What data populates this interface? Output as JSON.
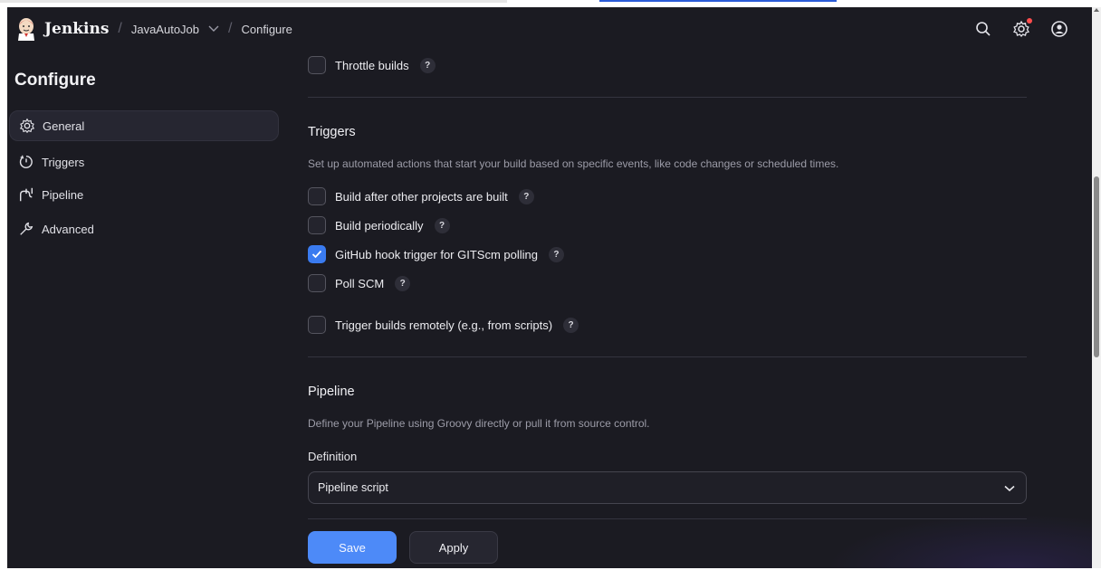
{
  "header": {
    "brand": "Jenkins",
    "breadcrumbs": [
      "JavaAutoJob",
      "Configure"
    ],
    "icons": [
      "search-icon",
      "settings-icon",
      "account-icon"
    ]
  },
  "sidebar": {
    "title": "Configure",
    "items": [
      {
        "label": "General",
        "icon": "gear-icon",
        "active": true
      },
      {
        "label": "Triggers",
        "icon": "timer-icon",
        "active": false
      },
      {
        "label": "Pipeline",
        "icon": "pipeline-icon",
        "active": false
      },
      {
        "label": "Advanced",
        "icon": "wrench-icon",
        "active": false
      }
    ]
  },
  "main": {
    "throttle": {
      "label": "Throttle builds",
      "checked": false
    },
    "triggers": {
      "title": "Triggers",
      "description": "Set up automated actions that start your build based on specific events, like code changes or scheduled times.",
      "options": [
        {
          "label": "Build after other projects are built",
          "checked": false
        },
        {
          "label": "Build periodically",
          "checked": false
        },
        {
          "label": "GitHub hook trigger for GITScm polling",
          "checked": true
        },
        {
          "label": "Poll SCM",
          "checked": false
        },
        {
          "label": "Trigger builds remotely (e.g., from scripts)",
          "checked": false
        }
      ]
    },
    "pipeline": {
      "title": "Pipeline",
      "description": "Define your Pipeline using Groovy directly or pull it from source control.",
      "definition_label": "Definition",
      "definition_value": "Pipeline script"
    },
    "help_glyph": "?",
    "buttons": {
      "save": "Save",
      "apply": "Apply"
    }
  },
  "colors": {
    "accent": "#4d8af8",
    "background": "#1b1b22",
    "checked": "#3a7bf0",
    "notification": "#ff4d4d"
  }
}
